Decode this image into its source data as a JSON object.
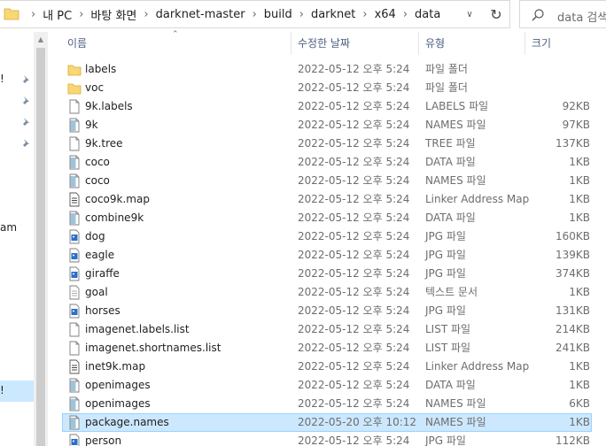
{
  "address_bar": {
    "breadcrumbs": [
      "내 PC",
      "바탕 화면",
      "darknet-master",
      "build",
      "darknet",
      "x64",
      "data"
    ],
    "separator": "›",
    "dropdown_icon": "chevron-down-icon",
    "refresh_icon": "refresh-icon"
  },
  "search": {
    "placeholder": "data 검색"
  },
  "nav_pane": {
    "fragments": [
      "!",
      "am",
      "!"
    ],
    "pinned_count": 4
  },
  "columns": {
    "name": "이름",
    "date": "수정한 날짜",
    "type": "유형",
    "size": "크기"
  },
  "files": [
    {
      "name": "labels",
      "date": "2022-05-12 오후 5:24",
      "type": "파일 폴더",
      "size": "",
      "icon": "folder-icon"
    },
    {
      "name": "voc",
      "date": "2022-05-12 오후 5:24",
      "type": "파일 폴더",
      "size": "",
      "icon": "folder-icon"
    },
    {
      "name": "9k.labels",
      "date": "2022-05-12 오후 5:24",
      "type": "LABELS 파일",
      "size": "92KB",
      "icon": "file-icon"
    },
    {
      "name": "9k",
      "date": "2022-05-12 오후 5:24",
      "type": "NAMES 파일",
      "size": "97KB",
      "icon": "names-file-icon"
    },
    {
      "name": "9k.tree",
      "date": "2022-05-12 오후 5:24",
      "type": "TREE 파일",
      "size": "137KB",
      "icon": "file-icon"
    },
    {
      "name": "coco",
      "date": "2022-05-12 오후 5:24",
      "type": "DATA 파일",
      "size": "1KB",
      "icon": "names-file-icon"
    },
    {
      "name": "coco",
      "date": "2022-05-12 오후 5:24",
      "type": "NAMES 파일",
      "size": "1KB",
      "icon": "names-file-icon"
    },
    {
      "name": "coco9k.map",
      "date": "2022-05-12 오후 5:24",
      "type": "Linker Address Map",
      "size": "1KB",
      "icon": "map-file-icon"
    },
    {
      "name": "combine9k",
      "date": "2022-05-12 오후 5:24",
      "type": "DATA 파일",
      "size": "1KB",
      "icon": "names-file-icon"
    },
    {
      "name": "dog",
      "date": "2022-05-12 오후 5:24",
      "type": "JPG 파일",
      "size": "160KB",
      "icon": "image-file-icon"
    },
    {
      "name": "eagle",
      "date": "2022-05-12 오후 5:24",
      "type": "JPG 파일",
      "size": "139KB",
      "icon": "image-file-icon"
    },
    {
      "name": "giraffe",
      "date": "2022-05-12 오후 5:24",
      "type": "JPG 파일",
      "size": "374KB",
      "icon": "image-file-icon"
    },
    {
      "name": "goal",
      "date": "2022-05-12 오후 5:24",
      "type": "텍스트 문서",
      "size": "1KB",
      "icon": "text-file-icon"
    },
    {
      "name": "horses",
      "date": "2022-05-12 오후 5:24",
      "type": "JPG 파일",
      "size": "131KB",
      "icon": "image-file-icon"
    },
    {
      "name": "imagenet.labels.list",
      "date": "2022-05-12 오후 5:24",
      "type": "LIST 파일",
      "size": "214KB",
      "icon": "file-icon"
    },
    {
      "name": "imagenet.shortnames.list",
      "date": "2022-05-12 오후 5:24",
      "type": "LIST 파일",
      "size": "241KB",
      "icon": "file-icon"
    },
    {
      "name": "inet9k.map",
      "date": "2022-05-12 오후 5:24",
      "type": "Linker Address Map",
      "size": "1KB",
      "icon": "map-file-icon"
    },
    {
      "name": "openimages",
      "date": "2022-05-12 오후 5:24",
      "type": "DATA 파일",
      "size": "1KB",
      "icon": "names-file-icon"
    },
    {
      "name": "openimages",
      "date": "2022-05-12 오후 5:24",
      "type": "NAMES 파일",
      "size": "6KB",
      "icon": "names-file-icon"
    },
    {
      "name": "package.names",
      "date": "2022-05-20 오후 10:12",
      "type": "NAMES 파일",
      "size": "1KB",
      "icon": "names-file-icon",
      "selected": true
    },
    {
      "name": "person",
      "date": "2022-05-12 오후 5:24",
      "type": "JPG 파일",
      "size": "112KB",
      "icon": "image-file-icon"
    }
  ],
  "colors": {
    "selection": "#cce8ff",
    "selection_border": "#99d1ff",
    "folder": "#f8d775",
    "header_text": "#4d6082"
  }
}
